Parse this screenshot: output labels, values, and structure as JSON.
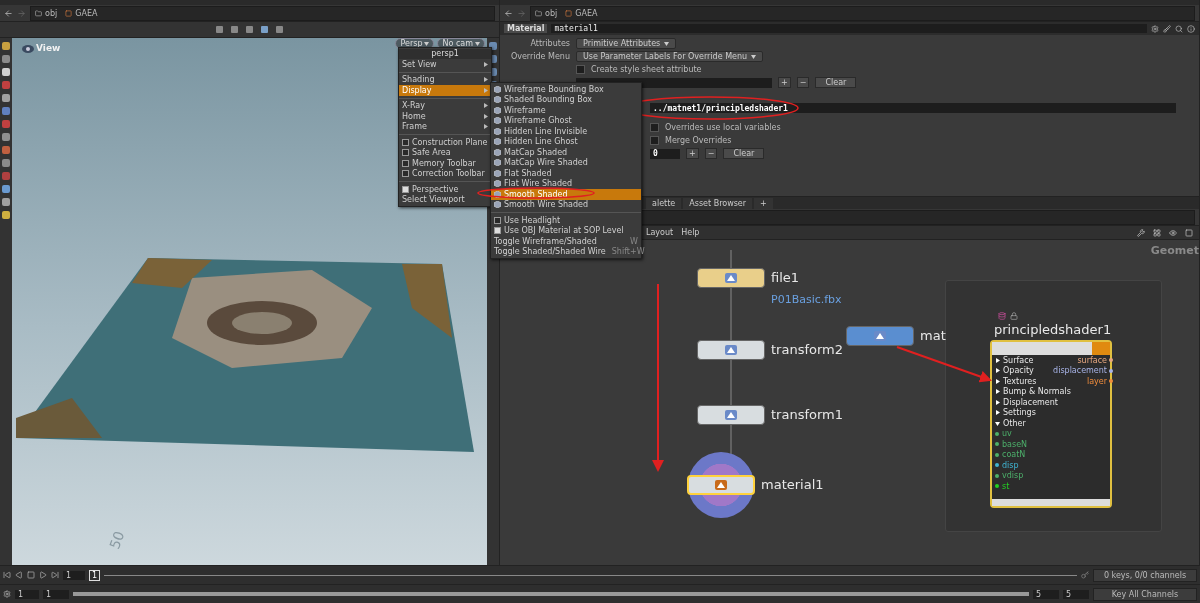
{
  "viewer": {
    "path": [
      "obj",
      "GAEA"
    ],
    "title": "View",
    "camera_menus": [
      "Persp",
      "No cam"
    ],
    "grid_label": "50",
    "view_menu": {
      "title": "persp1",
      "items": [
        {
          "kind": "submenu",
          "label": "Set View",
          "selected": false
        },
        {
          "kind": "separator"
        },
        {
          "kind": "submenu",
          "label": "Shading",
          "selected": false
        },
        {
          "kind": "submenu",
          "label": "Display",
          "selected": true
        },
        {
          "kind": "separator"
        },
        {
          "kind": "submenu",
          "label": "X-Ray",
          "selected": false
        },
        {
          "kind": "submenu",
          "label": "Home",
          "selected": false
        },
        {
          "kind": "submenu",
          "label": "Frame",
          "selected": false
        },
        {
          "kind": "separator"
        },
        {
          "kind": "check",
          "label": "Construction Plane",
          "checked": false
        },
        {
          "kind": "check",
          "label": "Safe Area",
          "checked": false
        },
        {
          "kind": "check",
          "label": "Memory Toolbar",
          "checked": false
        },
        {
          "kind": "check",
          "label": "Correction Toolbar",
          "checked": false
        },
        {
          "kind": "separator"
        },
        {
          "kind": "check",
          "label": "Perspective",
          "checked": true
        },
        {
          "kind": "action",
          "label": "Select Viewport"
        }
      ]
    },
    "display_menu": {
      "items": [
        {
          "kind": "mode",
          "label": "Wireframe Bounding Box",
          "selected": false
        },
        {
          "kind": "mode",
          "label": "Shaded Bounding Box",
          "selected": false
        },
        {
          "kind": "mode",
          "label": "Wireframe",
          "selected": false
        },
        {
          "kind": "mode",
          "label": "Wireframe Ghost",
          "selected": false
        },
        {
          "kind": "mode",
          "label": "Hidden Line Invisible",
          "selected": false
        },
        {
          "kind": "mode",
          "label": "Hidden Line Ghost",
          "selected": false
        },
        {
          "kind": "mode",
          "label": "MatCap Shaded",
          "selected": false
        },
        {
          "kind": "mode",
          "label": "MatCap Wire Shaded",
          "selected": false
        },
        {
          "kind": "mode",
          "label": "Flat Shaded",
          "selected": false
        },
        {
          "kind": "mode",
          "label": "Flat Wire Shaded",
          "selected": false
        },
        {
          "kind": "mode",
          "label": "Smooth Shaded",
          "selected": true
        },
        {
          "kind": "mode",
          "label": "Smooth Wire Shaded",
          "selected": false
        },
        {
          "kind": "separator"
        },
        {
          "kind": "check",
          "label": "Use Headlight",
          "checked": false
        },
        {
          "kind": "check",
          "label": "Use OBJ Material at SOP Level",
          "checked": true
        },
        {
          "kind": "action",
          "label": "Toggle Wireframe/Shaded",
          "shortcut": "W"
        },
        {
          "kind": "action",
          "label": "Toggle Shaded/Shaded Wire",
          "shortcut": "Shift+W"
        }
      ]
    }
  },
  "parameters": {
    "path": [
      "obj",
      "GAEA"
    ],
    "node_type": "Material",
    "node_name": "material1",
    "rows": [
      {
        "kind": "menu",
        "label": "Attributes",
        "value": "Primitive Attributes"
      },
      {
        "kind": "menu",
        "label": "Override Menu",
        "value": "Use Parameter Labels For Override Menu"
      },
      {
        "kind": "check",
        "label": "Create style sheet attribute",
        "checked": false
      },
      {
        "kind": "list",
        "buttons": [
          "+",
          "−",
          "Clear"
        ]
      }
    ],
    "overrides": [
      {
        "kind": "path",
        "value": "../matnet1/principledshader1"
      },
      {
        "kind": "check",
        "label": "Overrides use local variables",
        "checked": false
      },
      {
        "kind": "check",
        "label": "Merge Overrides",
        "checked": false
      },
      {
        "kind": "count",
        "value": "0",
        "buttons": [
          "+",
          "−",
          "Clear"
        ]
      }
    ]
  },
  "pane_tabs": [
    {
      "label": "alette",
      "selected": false
    },
    {
      "label": "Asset Browser",
      "selected": false
    }
  ],
  "add_tab": "+",
  "network": {
    "menu": [
      "Layout",
      "Help"
    ],
    "context_label": "Geomet",
    "nodes": [
      {
        "kind": "file",
        "name": "file1",
        "detail": "P01Basic.fbx",
        "selected": false
      },
      {
        "kind": "transform",
        "name": "transform2",
        "selected": false
      },
      {
        "kind": "transform",
        "name": "transform1",
        "selected": false
      },
      {
        "kind": "material",
        "name": "material1",
        "selected": true
      },
      {
        "kind": "matnet",
        "name": "mat",
        "selected": false
      }
    ],
    "shader": {
      "name": "principledshader1",
      "inputs": [
        {
          "kind": "folder",
          "label": "Surface",
          "expanded": false
        },
        {
          "kind": "folder",
          "label": "Opacity",
          "expanded": false
        },
        {
          "kind": "folder",
          "label": "Textures",
          "expanded": false
        },
        {
          "kind": "folder",
          "label": "Bump & Normals",
          "expanded": false
        },
        {
          "kind": "folder",
          "label": "Displacement",
          "expanded": false
        },
        {
          "kind": "folder",
          "label": "Settings",
          "expanded": false
        },
        {
          "kind": "folder",
          "label": "Other",
          "expanded": true
        },
        {
          "kind": "input",
          "label": "uv",
          "color": "#4caf6a"
        },
        {
          "kind": "input",
          "label": "baseN",
          "color": "#4caf6a"
        },
        {
          "kind": "input",
          "label": "coatN",
          "color": "#4caf6a"
        },
        {
          "kind": "input",
          "label": "disp",
          "color": "#3fb4d2"
        },
        {
          "kind": "input",
          "label": "vdisp",
          "color": "#4caf6a"
        },
        {
          "kind": "input",
          "label": "st",
          "color": "#22d022"
        }
      ],
      "outputs": [
        {
          "label": "surface",
          "color": "#e8a880"
        },
        {
          "label": "displacement",
          "color": "#a8b4e8"
        },
        {
          "label": "layer",
          "color": "#f08c3c"
        }
      ]
    }
  },
  "timeline": {
    "level": 1,
    "current_frame": "1",
    "frame_marker": "1",
    "start": [
      "1",
      "1"
    ],
    "end": [
      "5",
      "5"
    ],
    "keys_status": "0 keys, 0/0 channels",
    "key_all": "Key All Channels"
  }
}
